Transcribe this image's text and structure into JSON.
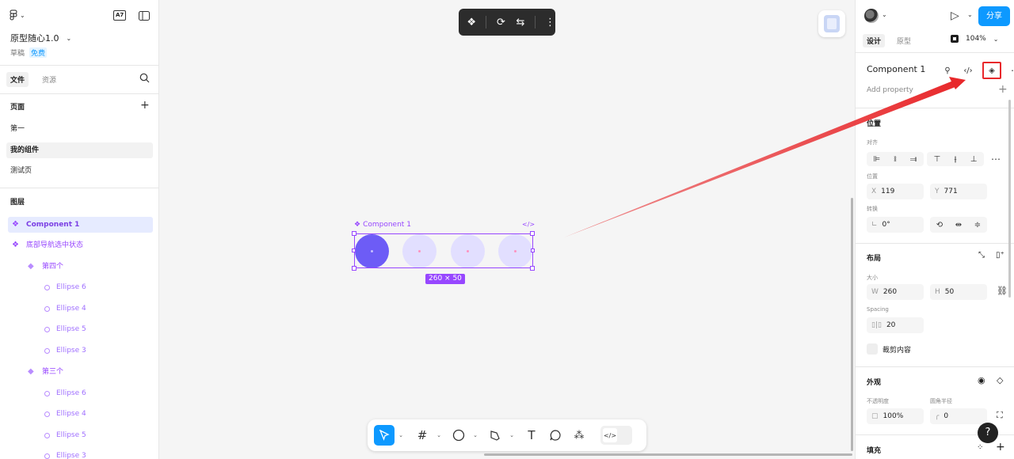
{
  "app": {
    "project_title": "原型随心1.0",
    "draft_label": "草稿",
    "plan_badge": "免费",
    "a7_badge": "A7"
  },
  "left_panel": {
    "tabs": [
      {
        "label": "文件",
        "active": true
      },
      {
        "label": "资源",
        "active": false
      }
    ],
    "pages_title": "页面",
    "pages": [
      {
        "label": "第一",
        "selected": false
      },
      {
        "label": "我的组件",
        "selected": true
      },
      {
        "label": "测试页",
        "selected": false
      }
    ],
    "layers_title": "图层",
    "layers": [
      {
        "label": "Component 1",
        "type": "component",
        "indent": 0,
        "selected": true
      },
      {
        "label": "底部导航选中状态",
        "type": "component",
        "indent": 0,
        "selected": false
      },
      {
        "label": "第四个",
        "type": "instance",
        "indent": 1,
        "selected": false
      },
      {
        "label": "Ellipse 6",
        "type": "ellipse",
        "indent": 2,
        "selected": false
      },
      {
        "label": "Ellipse 4",
        "type": "ellipse",
        "indent": 2,
        "selected": false
      },
      {
        "label": "Ellipse 5",
        "type": "ellipse",
        "indent": 2,
        "selected": false
      },
      {
        "label": "Ellipse 3",
        "type": "ellipse",
        "indent": 2,
        "selected": false
      },
      {
        "label": "第三个",
        "type": "instance",
        "indent": 1,
        "selected": false
      },
      {
        "label": "Ellipse 6",
        "type": "ellipse",
        "indent": 2,
        "selected": false
      },
      {
        "label": "Ellipse 4",
        "type": "ellipse",
        "indent": 2,
        "selected": false
      },
      {
        "label": "Ellipse 5",
        "type": "ellipse",
        "indent": 2,
        "selected": false
      },
      {
        "label": "Ellipse 3",
        "type": "ellipse",
        "indent": 2,
        "selected": false
      }
    ]
  },
  "canvas": {
    "component_label": "Component 1",
    "code_glyph": "</>",
    "size_badge": "260 × 50",
    "colors": {
      "selection": "#9747ff",
      "active_circle": "#6d5cf6",
      "inactive_circle": "#e2dfff",
      "annotation_arrow": "#e8282b"
    },
    "bottom_tools": [
      "move",
      "frame",
      "ellipse",
      "pen",
      "text",
      "comment",
      "components",
      "dev-mode"
    ],
    "top_toolbar_tools": [
      "component-set",
      "instance-swap",
      "swap",
      "more"
    ]
  },
  "right_panel": {
    "share_label": "分享",
    "tabs": [
      {
        "label": "设计",
        "active": true
      },
      {
        "label": "原型",
        "active": false
      }
    ],
    "zoom": "104%",
    "component_name": "Component 1",
    "add_property": "Add property",
    "position_title": "位置",
    "align_label": "对齐",
    "pos_label": "位置",
    "x_label": "X",
    "x_value": "119",
    "y_label": "Y",
    "y_value": "771",
    "rotate_label": "转换",
    "rotation_value": "0°",
    "layout_title": "布局",
    "size_label": "大小",
    "w_label": "W",
    "w_value": "260",
    "h_label": "H",
    "h_value": "50",
    "spacing_label": "Spacing",
    "spacing_value": "20",
    "clip_label": "裁剪内容",
    "appearance_title": "外观",
    "opacity_label": "不透明度",
    "radius_label": "圆角半径",
    "opacity_value": "100%",
    "radius_value": "0",
    "fill_title": "填充",
    "help_label": "?"
  }
}
